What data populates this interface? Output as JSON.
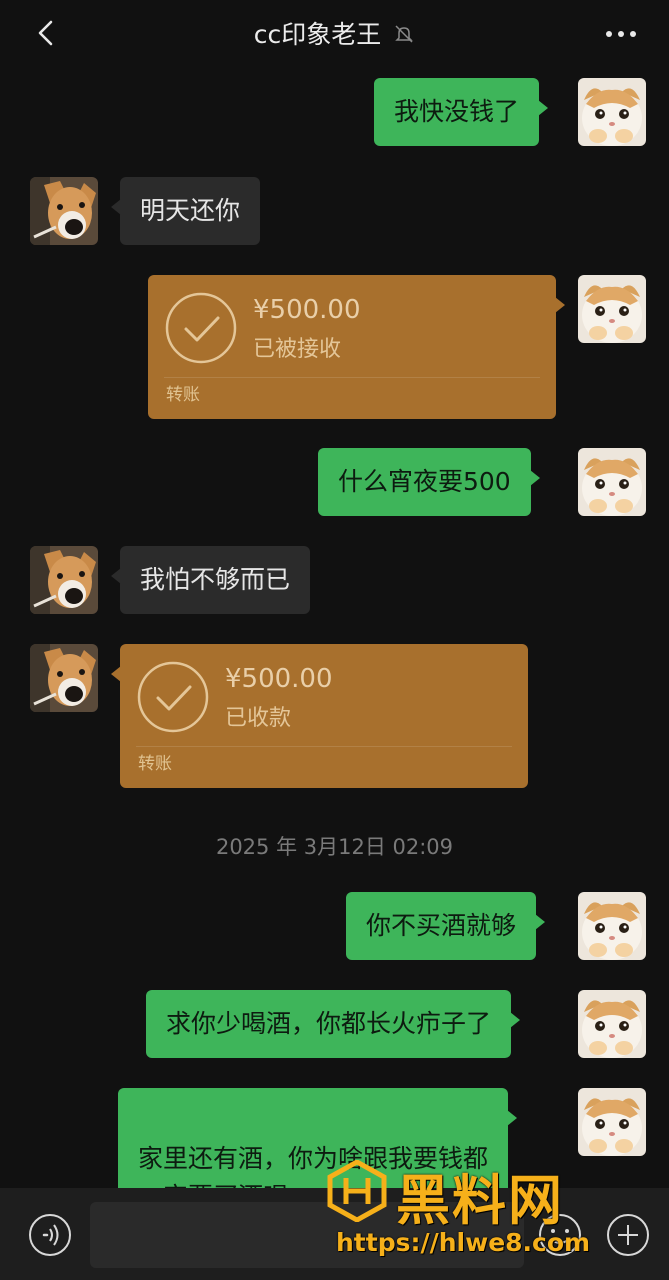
{
  "header": {
    "title": "cc印象老王",
    "back_icon": "chevron-left-icon",
    "mute_icon": "bell-off-icon",
    "more_icon": "more-dots-icon"
  },
  "messages": [
    {
      "side": "right",
      "type": "text",
      "text": "我快没钱了"
    },
    {
      "side": "left",
      "type": "text",
      "text": "明天还你"
    },
    {
      "side": "right",
      "type": "transfer",
      "amount": "¥500.00",
      "status": "已被接收",
      "label": "转账"
    },
    {
      "side": "right",
      "type": "text",
      "text": "什么宵夜要500"
    },
    {
      "side": "left",
      "type": "text",
      "text": "我怕不够而已"
    },
    {
      "side": "left",
      "type": "transfer",
      "amount": "¥500.00",
      "status": "已收款",
      "label": "转账"
    },
    {
      "side": "center",
      "type": "timestamp",
      "text": "2025 年 3月12日 02:09"
    },
    {
      "side": "right",
      "type": "text",
      "text": "你不买酒就够"
    },
    {
      "side": "right",
      "type": "text",
      "text": "求你少喝酒，你都长火疖子了"
    },
    {
      "side": "right",
      "type": "text",
      "text": "家里还有酒，你为啥跟我要钱都\n一定要买酒喝"
    }
  ],
  "input_bar": {
    "voice_icon": "voice-icon",
    "emoji_icon": "emoji-icon",
    "plus_icon": "plus-icon"
  },
  "watermark": {
    "brand": "黑料网",
    "url": "https://hlwe8.com"
  },
  "colors": {
    "background": "#111111",
    "outgoing_bubble": "#3eb55a",
    "incoming_bubble": "#2b2b2b",
    "transfer_card": "#a8702d",
    "watermark": "#f6b01a"
  }
}
